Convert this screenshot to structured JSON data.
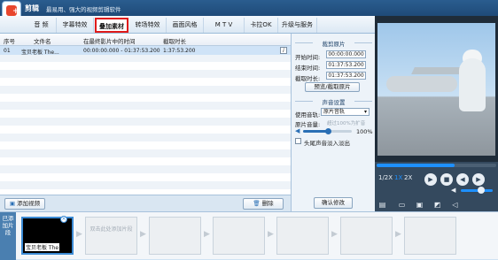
{
  "app": {
    "title": "剪辑",
    "slogan": "最易用、强大的视频剪辑软件"
  },
  "tabs": [
    {
      "label": "音 频"
    },
    {
      "label": "字幕特效"
    },
    {
      "label": "叠加素材"
    },
    {
      "label": "转场特效"
    },
    {
      "label": "画面风格"
    },
    {
      "label": "M T V"
    },
    {
      "label": "卡拉OK"
    },
    {
      "label": "升级与服务"
    }
  ],
  "clip_list": {
    "headers": [
      "序号",
      "文件名",
      "在最终影片中的时间",
      "截取时长"
    ],
    "rows": [
      {
        "index": "01",
        "filename": "宝贝老板 The...",
        "time": "00:00:00.000 - 01:37:53.200",
        "duration": "1:37:53.200"
      }
    ],
    "info_icon_glyph": "i"
  },
  "bottom": {
    "add_video": "添加视频",
    "delete": "删除"
  },
  "side": {
    "cut_section_title": "裁剪原片",
    "start_label": "开始时间:",
    "start_value": "00:00:00.000",
    "end_label": "结束时间:",
    "end_value": "01:37:53.200",
    "duration_label": "截取时长:",
    "duration_value": "01:37:53.200",
    "preview_button": "预览/截取原片",
    "audio_section_title": "声音设置",
    "audio_source_label": "使用音轨:",
    "audio_source_value": "原片音轨",
    "volume_label": "原片音量:",
    "volume_hint": "超过100%为扩音",
    "volume_value": "100%",
    "volume_level": 0.5,
    "fade_label": "头尾声音淡入淡出",
    "fade_checked": false,
    "confirm_button": "确认修改"
  },
  "player": {
    "progress": 0.65,
    "speeds": [
      "1/2X",
      "1X",
      "2X"
    ],
    "volume_level": 0.65
  },
  "timeline": {
    "label": "已添加片段",
    "active_clip_label": "宝贝老板 The",
    "empty_hint": "双击此处添加片段",
    "empty_slots": 6
  },
  "colors": {
    "accent": "#1e90ff",
    "tab_highlight": "#e01b1b",
    "titlebar": "#2a5d8f"
  }
}
